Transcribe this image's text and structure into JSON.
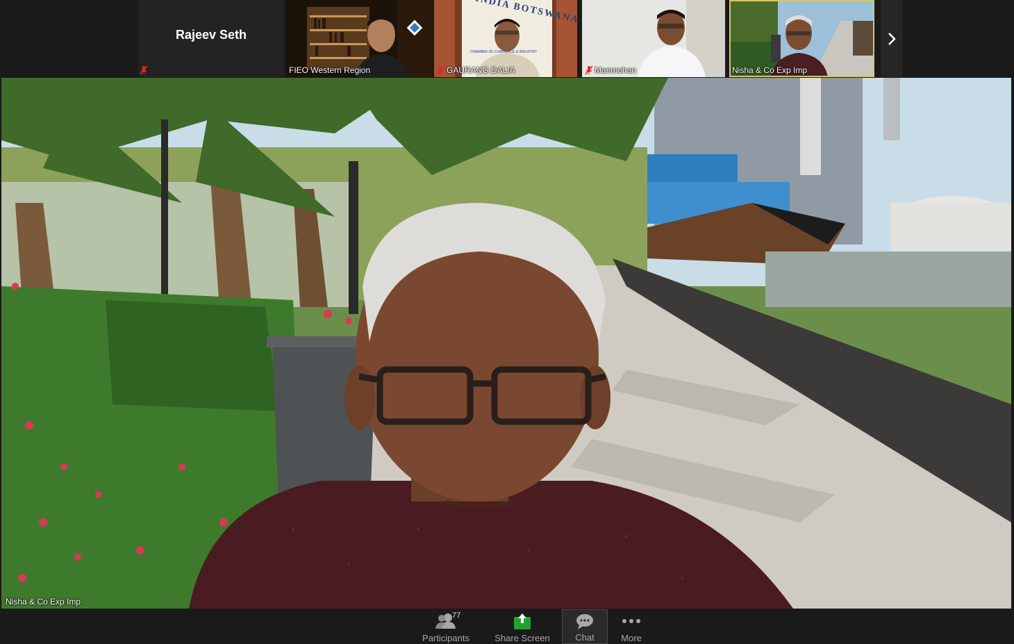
{
  "filmstrip": {
    "tiles": [
      {
        "name": "Rajeev Seth",
        "muted": true
      },
      {
        "name": "FIEO Western Region",
        "muted": false
      },
      {
        "name": "GAURANG DALIA",
        "muted": true
      },
      {
        "name": "Manmohan",
        "muted": true
      },
      {
        "name": "Nisha & Co Exp Imp",
        "muted": false
      }
    ],
    "logo_text": "INDIA BOTSWANA",
    "logo_sub": "CHAMBER OF COMMERCE & INDUSTRY"
  },
  "main": {
    "speaker_name": "Nisha & Co Exp Imp"
  },
  "toolbar": {
    "participants_label": "Participants",
    "participants_count": "77",
    "share_label": "Share Screen",
    "chat_label": "Chat",
    "more_label": "More"
  },
  "colors": {
    "background": "#1a1a1a",
    "share_green": "#23a032",
    "active_border": "#d6c86a",
    "muted_red": "#e02828"
  }
}
